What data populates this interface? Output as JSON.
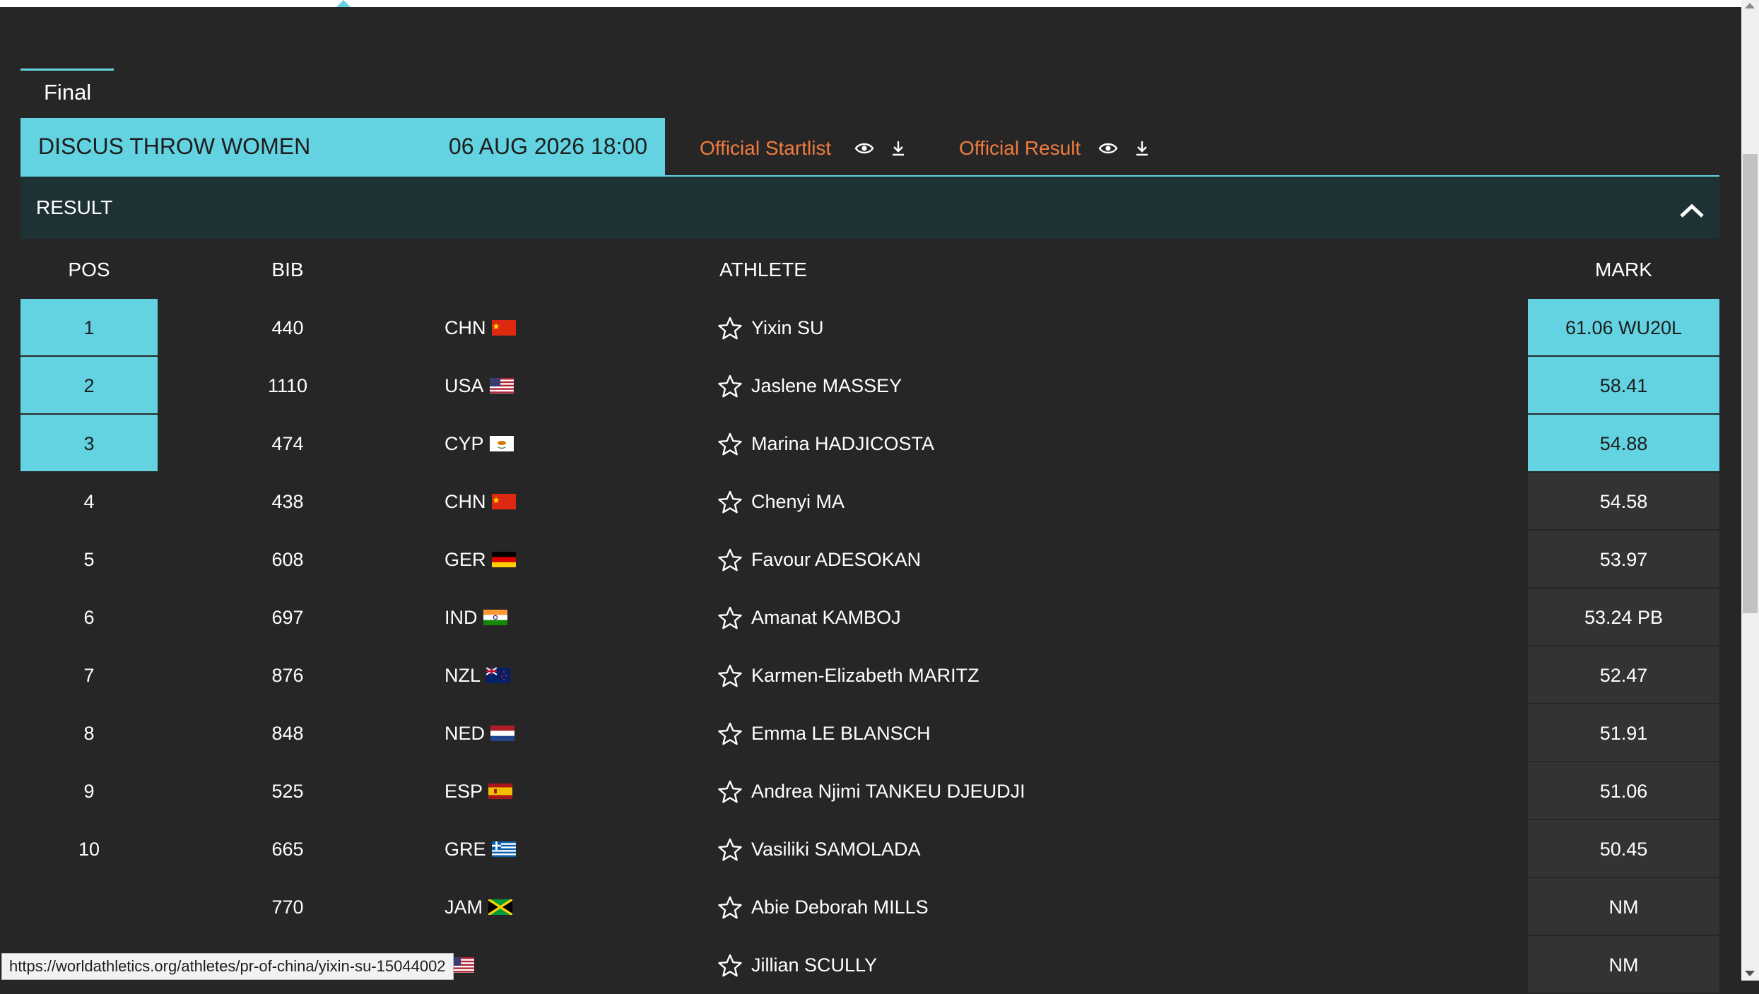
{
  "tab": {
    "label": "Final"
  },
  "event": {
    "name": "DISCUS THROW WOMEN",
    "datetime": "06 AUG 2026 18:00"
  },
  "docs": {
    "startlist_label": "Official Startlist",
    "result_label": "Official Result"
  },
  "section": {
    "title": "RESULT"
  },
  "table": {
    "headers": {
      "pos": "POS",
      "bib": "BIB",
      "athlete": "ATHLETE",
      "mark": "MARK"
    },
    "rows": [
      {
        "pos": "1",
        "bib": "440",
        "nat": "CHN",
        "athlete": "Yixin SU",
        "mark": "61.06 WU20L"
      },
      {
        "pos": "2",
        "bib": "1110",
        "nat": "USA",
        "athlete": "Jaslene MASSEY",
        "mark": "58.41"
      },
      {
        "pos": "3",
        "bib": "474",
        "nat": "CYP",
        "athlete": "Marina HADJICOSTA",
        "mark": "54.88"
      },
      {
        "pos": "4",
        "bib": "438",
        "nat": "CHN",
        "athlete": "Chenyi MA",
        "mark": "54.58"
      },
      {
        "pos": "5",
        "bib": "608",
        "nat": "GER",
        "athlete": "Favour ADESOKAN",
        "mark": "53.97"
      },
      {
        "pos": "6",
        "bib": "697",
        "nat": "IND",
        "athlete": "Amanat KAMBOJ",
        "mark": "53.24 PB"
      },
      {
        "pos": "7",
        "bib": "876",
        "nat": "NZL",
        "athlete": "Karmen-Elizabeth MARITZ",
        "mark": "52.47"
      },
      {
        "pos": "8",
        "bib": "848",
        "nat": "NED",
        "athlete": "Emma LE BLANSCH",
        "mark": "51.91"
      },
      {
        "pos": "9",
        "bib": "525",
        "nat": "ESP",
        "athlete": "Andrea Njimi TANKEU DJEUDJI",
        "mark": "51.06"
      },
      {
        "pos": "10",
        "bib": "665",
        "nat": "GRE",
        "athlete": "Vasiliki SAMOLADA",
        "mark": "50.45"
      },
      {
        "pos": "",
        "bib": "770",
        "nat": "JAM",
        "athlete": "Abie Deborah MILLS",
        "mark": "NM"
      },
      {
        "pos": "",
        "bib": "",
        "nat": "",
        "athlete": "Jillian SCULLY",
        "mark": "NM"
      }
    ]
  },
  "status_bar": {
    "url": "https://worldathletics.org/athletes/pr-of-china/yixin-su-15044002"
  },
  "colors": {
    "accent": "#63d3e1",
    "link": "#f07c3e",
    "background": "#262626",
    "result_bar": "#1e3236"
  },
  "icons": {
    "view": "eye-icon",
    "download": "download-icon",
    "collapse": "chevron-up-icon",
    "favorite": "star-outline-icon"
  }
}
